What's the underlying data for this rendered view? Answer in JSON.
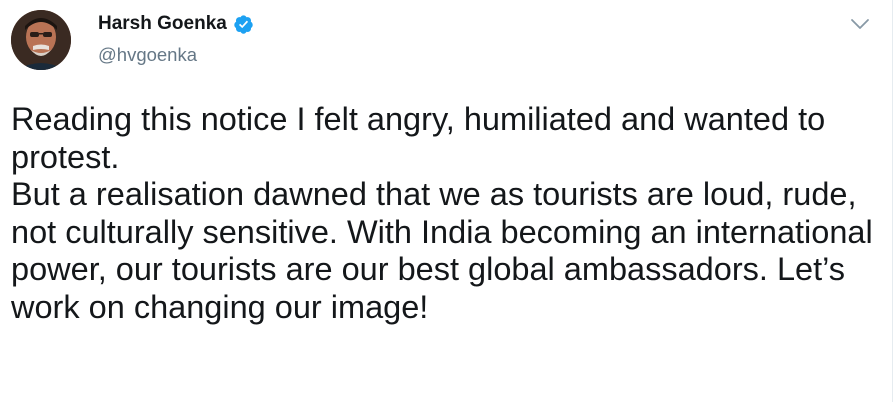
{
  "author": {
    "display_name": "Harsh Goenka",
    "handle": "@hvgoenka",
    "verified": true,
    "avatar_icon": "profile-photo"
  },
  "menu": {
    "icon": "chevron-down-icon"
  },
  "tweet": {
    "paragraph_1": "Reading this notice I felt angry, humiliated and wanted to protest.",
    "paragraph_2": "But a realisation dawned that we as tourists are loud, rude, not culturally sensitive. With India becoming an international power, our tourists are our best global ambassadors. Let’s work on changing our image!"
  },
  "colors": {
    "text_primary": "#14171a",
    "text_secondary": "#657786",
    "verified_blue": "#1da1f2"
  }
}
